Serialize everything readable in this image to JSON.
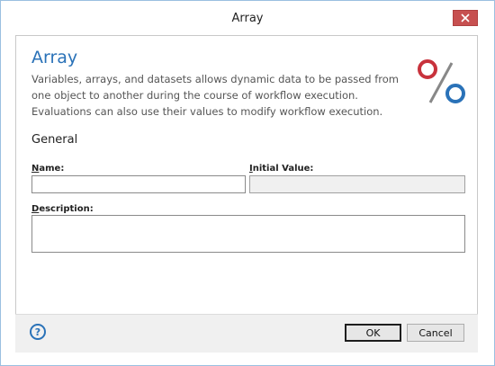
{
  "window": {
    "title": "Array"
  },
  "header": {
    "title": "Array",
    "description": "Variables, arrays, and datasets allows dynamic data to be passed from one object to another during the course of workflow execution. Evaluations can also use their values to modify workflow execution.",
    "logo_icon": "percent-icon",
    "logo_colors": {
      "circle_top": "#c8323c",
      "slash": "#888888",
      "circle_bottom": "#2a72b8"
    }
  },
  "section": {
    "title": "General"
  },
  "fields": {
    "name": {
      "label_accel": "N",
      "label_rest": "ame:",
      "value": ""
    },
    "initial_value": {
      "label_accel": "I",
      "label_rest": "nitial Value:",
      "value": ""
    },
    "description": {
      "label_accel": "D",
      "label_rest": "escription:",
      "value": ""
    }
  },
  "footer": {
    "help_icon": "help-icon",
    "help_glyph": "?",
    "ok_label": "OK",
    "cancel_label": "Cancel"
  },
  "colors": {
    "accent": "#2a72b8",
    "close_button": "#c75050"
  }
}
